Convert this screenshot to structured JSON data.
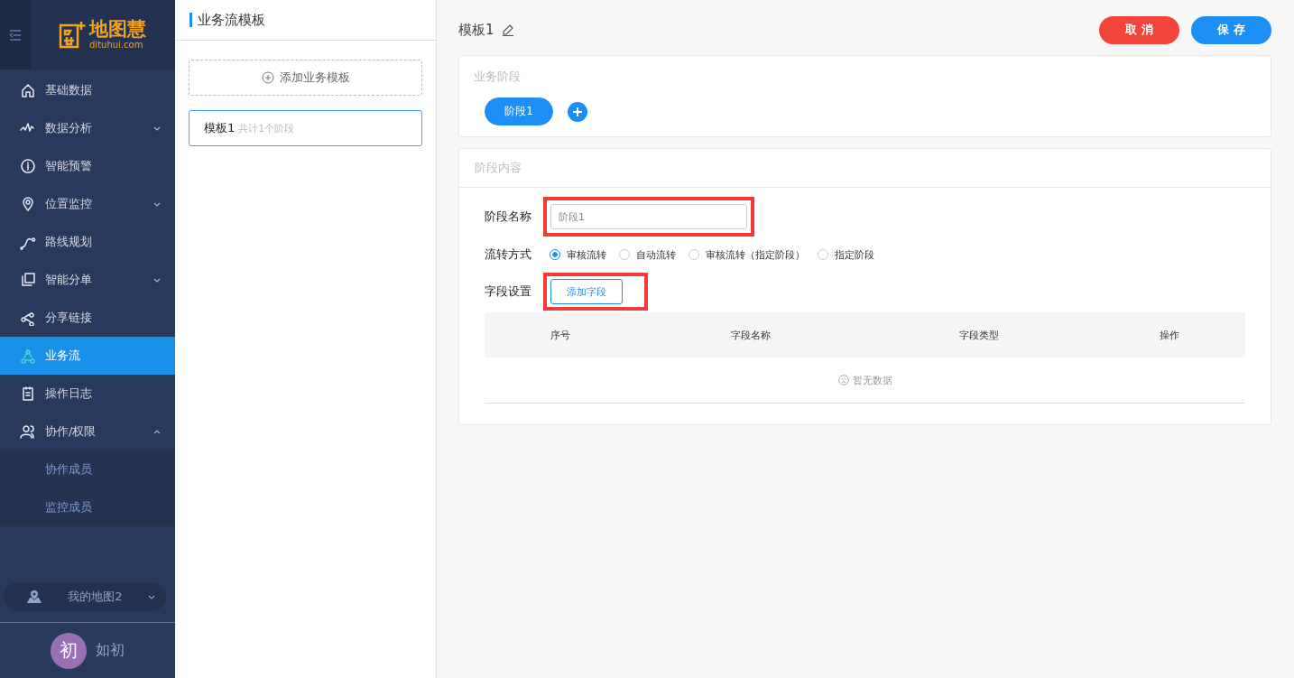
{
  "logo": {
    "name": "地图慧",
    "domain": "dituhui.com"
  },
  "sidebar": {
    "items": [
      {
        "kind": "link",
        "label": "基础数据",
        "selected": false
      },
      {
        "kind": "group",
        "label": "数据分析",
        "selected": false,
        "expanded": false
      },
      {
        "kind": "link",
        "label": "智能预警",
        "selected": false
      },
      {
        "kind": "group",
        "label": "位置监控",
        "selected": false,
        "expanded": false
      },
      {
        "kind": "link",
        "label": "路线规划",
        "selected": false
      },
      {
        "kind": "group",
        "label": "智能分单",
        "selected": false,
        "expanded": false
      },
      {
        "kind": "link",
        "label": "分享链接",
        "selected": false
      },
      {
        "kind": "link",
        "label": "业务流",
        "selected": true
      },
      {
        "kind": "link",
        "label": "操作日志",
        "selected": false
      },
      {
        "kind": "group",
        "label": "协作/权限",
        "selected": false,
        "expanded": true,
        "children": [
          {
            "label": "协作成员",
            "selected": false
          },
          {
            "label": "监控成员",
            "selected": false
          }
        ]
      }
    ],
    "map_selector": "我的地图2",
    "user": {
      "avatar_char": "初",
      "name": "如初"
    }
  },
  "templates": {
    "title": "业务流模板",
    "add_button": "添加业务模板",
    "items": [
      {
        "name": "模板1",
        "summary": "共计1个阶段",
        "selected": true
      }
    ]
  },
  "editor": {
    "title": "模板1",
    "cancel": "取 消",
    "save": "保 存",
    "stages": {
      "title": "业务阶段",
      "items": [
        {
          "label": "阶段1",
          "selected": true
        }
      ]
    },
    "content": {
      "title": "阶段内容",
      "name_label": "阶段名称",
      "name_value": "阶段1",
      "name_highlighted": true,
      "flow_label": "流转方式",
      "flow_options": [
        {
          "label": "审核流转",
          "selected": true
        },
        {
          "label": "自动流转",
          "selected": false
        },
        {
          "label": "审核流转（指定阶段）",
          "selected": false
        },
        {
          "label": "指定阶段",
          "selected": false
        }
      ],
      "fields_label": "字段设置",
      "add_field": "添加字段",
      "add_field_highlighted": true,
      "table": {
        "columns": [
          "序号",
          "字段名称",
          "字段类型",
          "操作"
        ],
        "empty": "暂无数据"
      }
    }
  }
}
